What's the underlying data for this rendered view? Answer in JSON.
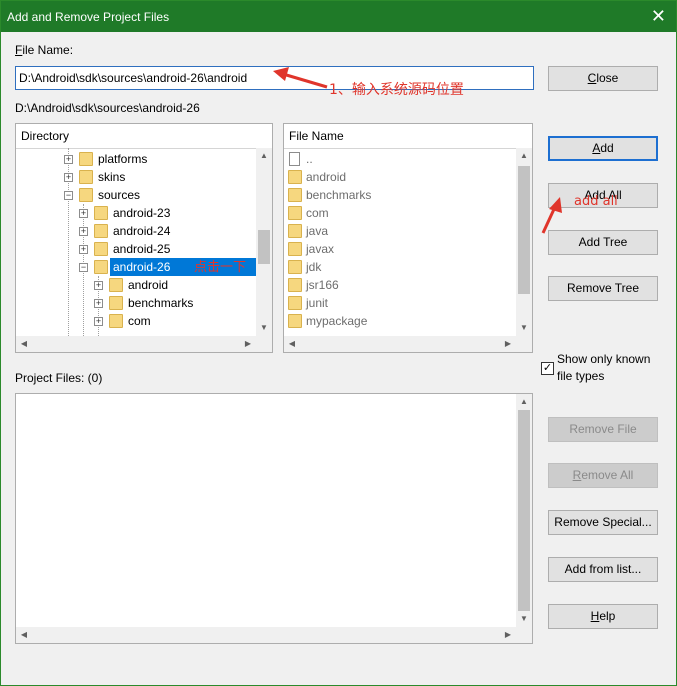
{
  "window": {
    "title": "Add and Remove Project Files",
    "close_glyph": "✕"
  },
  "file_name": {
    "label": "File Name:",
    "value": "D:\\Android\\sdk\\sources\\android-26\\android",
    "current_path": "D:\\Android\\sdk\\sources\\android-26"
  },
  "directory_panel": {
    "header": "Directory",
    "items": [
      {
        "label": "platforms",
        "expander": "+"
      },
      {
        "label": "skins",
        "expander": "+"
      },
      {
        "label": "sources",
        "expander": "−"
      },
      {
        "label": "android-23",
        "expander": "+"
      },
      {
        "label": "android-24",
        "expander": "+"
      },
      {
        "label": "android-25",
        "expander": "+"
      },
      {
        "label": "android-26",
        "expander": "−",
        "selected": true
      },
      {
        "label": "android",
        "expander": "+"
      },
      {
        "label": "benchmarks",
        "expander": "+"
      },
      {
        "label": "com",
        "expander": "+"
      }
    ]
  },
  "file_panel": {
    "header": "File Name",
    "items": [
      {
        "label": "..",
        "icon": "file-icon"
      },
      {
        "label": "android",
        "icon": "folder-icon"
      },
      {
        "label": "benchmarks",
        "icon": "folder-icon"
      },
      {
        "label": "com",
        "icon": "folder-icon"
      },
      {
        "label": "java",
        "icon": "folder-icon"
      },
      {
        "label": "javax",
        "icon": "folder-icon"
      },
      {
        "label": "jdk",
        "icon": "folder-icon"
      },
      {
        "label": "jsr166",
        "icon": "folder-icon"
      },
      {
        "label": "junit",
        "icon": "folder-icon"
      },
      {
        "label": "mypackage",
        "icon": "folder-icon"
      }
    ]
  },
  "buttons": {
    "close": "Close",
    "add": "Add",
    "add_all": "Add All",
    "add_tree": "Add Tree",
    "remove_tree": "Remove Tree",
    "remove_file": "Remove File",
    "remove_all": "Remove All",
    "remove_special": "Remove Special...",
    "add_from_list": "Add from list...",
    "help": "Help"
  },
  "show_known": {
    "line1": "Show only known",
    "line2": "file types",
    "checked": true,
    "check_glyph": "✓"
  },
  "project_files": {
    "label": "Project Files: (0)"
  },
  "annotations": {
    "step1": "1、输入系统源码位置",
    "click_once": "点击一下",
    "add_all_note": "add all"
  },
  "colors": {
    "titlebar": "#1f7a28",
    "selection": "#0078d7",
    "annotation": "#e0352b",
    "default_button_border": "#1d6fd1"
  }
}
